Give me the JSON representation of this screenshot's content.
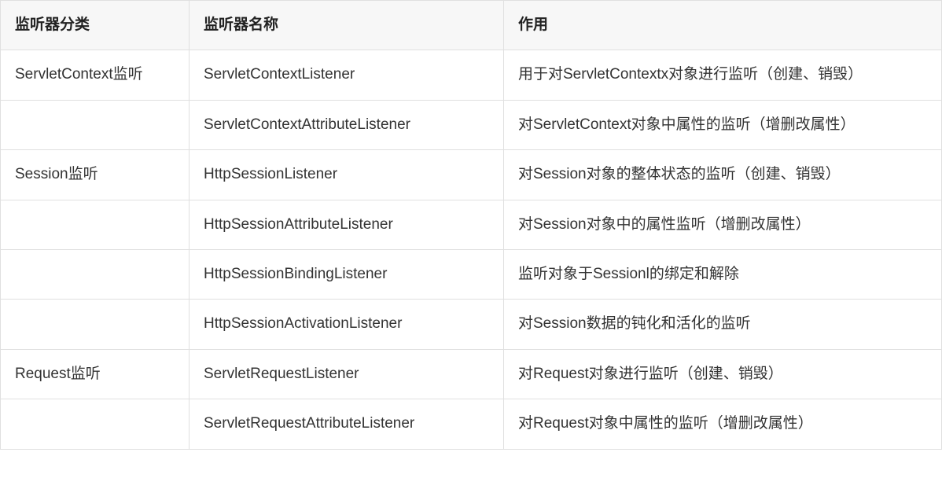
{
  "headers": {
    "c0": "监听器分类",
    "c1": "监听器名称",
    "c2": "作用"
  },
  "rows": [
    {
      "c0": "ServletContext监听",
      "c1": "ServletContextListener",
      "c2": "用于对ServletContextx对象进行监听（创建、销毁）"
    },
    {
      "c0": "",
      "c1": "ServletContextAttributeListener",
      "c2": "对ServletContext对象中属性的监听（增删改属性）"
    },
    {
      "c0": "Session监听",
      "c1": "HttpSessionListener",
      "c2": "对Session对象的整体状态的监听（创建、销毁）"
    },
    {
      "c0": "",
      "c1": "HttpSessionAttributeListener",
      "c2": "对Session对象中的属性监听（增删改属性）"
    },
    {
      "c0": "",
      "c1": "HttpSessionBindingListener",
      "c2": "监听对象于Sessionl的绑定和解除"
    },
    {
      "c0": "",
      "c1": "HttpSessionActivationListener",
      "c2": "对Session数据的钝化和活化的监听"
    },
    {
      "c0": "Request监听",
      "c1": "ServletRequestListener",
      "c2": "对Request对象进行监听（创建、销毁）"
    },
    {
      "c0": "",
      "c1": "ServletRequestAttributeListener",
      "c2": "对Request对象中属性的监听（增删改属性）"
    }
  ]
}
